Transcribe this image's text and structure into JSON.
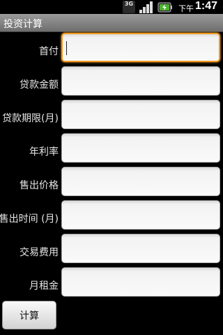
{
  "status_bar": {
    "network": "3G",
    "ampm": "下午",
    "time": "1:47"
  },
  "title": "投资计算",
  "form": {
    "fields": [
      {
        "label": "首付",
        "value": ""
      },
      {
        "label": "贷款金额",
        "value": ""
      },
      {
        "label": "贷款期限(月)",
        "value": ""
      },
      {
        "label": "年利率",
        "value": ""
      },
      {
        "label": "售出价格",
        "value": ""
      },
      {
        "label": "售出时间 (月)",
        "value": ""
      },
      {
        "label": "交易费用",
        "value": ""
      },
      {
        "label": "月租金",
        "value": ""
      }
    ]
  },
  "calculate_label": "计算"
}
